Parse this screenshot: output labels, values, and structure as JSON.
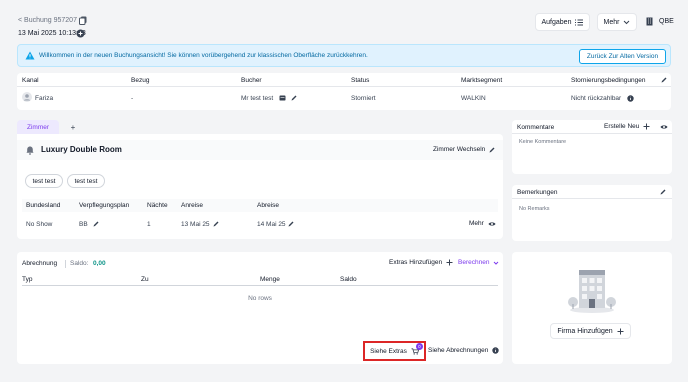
{
  "header": {
    "back_label": "< Buchung 957207",
    "datetime": "13 Mai 2025 10:13:08",
    "tasks_label": "Aufgaben",
    "more_label": "Mehr",
    "property_code": "QBE"
  },
  "banner": {
    "message": "Willkommen in der neuen Buchungsansicht! Sie können vorübergehend zur klassischen Oberfläche zurückkehren.",
    "button_label": "Zurück Zur Alten Version",
    "accent": "#0ea5e9"
  },
  "booking_table": {
    "headers": [
      "Kanal",
      "Bezug",
      "Bucher",
      "Status",
      "Marktsegment",
      "Stornierungsbedingungen"
    ],
    "row": {
      "kanal": "Fariza",
      "bezug": "-",
      "bucher": "Mr test test",
      "status": "Storniert",
      "marktsegment": "WALKIN",
      "storno": "Nicht rückzahlbar"
    }
  },
  "rooms": {
    "tab_label": "Zimmer",
    "add_tab": "+",
    "room_name": "Luxury Double Room",
    "change_room_label": "Zimmer Wechseln",
    "guests": [
      "test test",
      "test test"
    ],
    "table": {
      "headers": [
        "Bundesland",
        "Verpflegungsplan",
        "Nächte",
        "Anreise",
        "Abreise"
      ],
      "row": {
        "bundesland": "No Show",
        "plan": "BB",
        "naechte": "1",
        "anreise": "13 Mai 25",
        "abreise": "14 Mai 25",
        "more_label": "Mehr"
      }
    }
  },
  "comments": {
    "title": "Kommentare",
    "create_label": "Erstelle Neu",
    "empty_text": "Keine Kommentare"
  },
  "remarks": {
    "title": "Bemerkungen",
    "empty_text": "No Remarks"
  },
  "billing": {
    "title": "Abrechnung",
    "balance_label": "Saldo:",
    "balance_value": "0,00",
    "add_extras_label": "Extras Hinzufügen",
    "charge_label": "Berechnen",
    "columns": [
      "Typ",
      "Zu",
      "Menge",
      "Saldo"
    ],
    "empty_text": "No rows",
    "see_extras_label": "Siehe Extras",
    "extras_badge": "0",
    "see_billing_label": "Siehe Abrechnungen"
  },
  "company": {
    "add_label": "Firma Hinzufügen"
  },
  "colors": {
    "purple": "#7c3aed",
    "teal": "#0d9488",
    "highlight": "#dc2626",
    "page_bg": "#f3f4f6"
  }
}
